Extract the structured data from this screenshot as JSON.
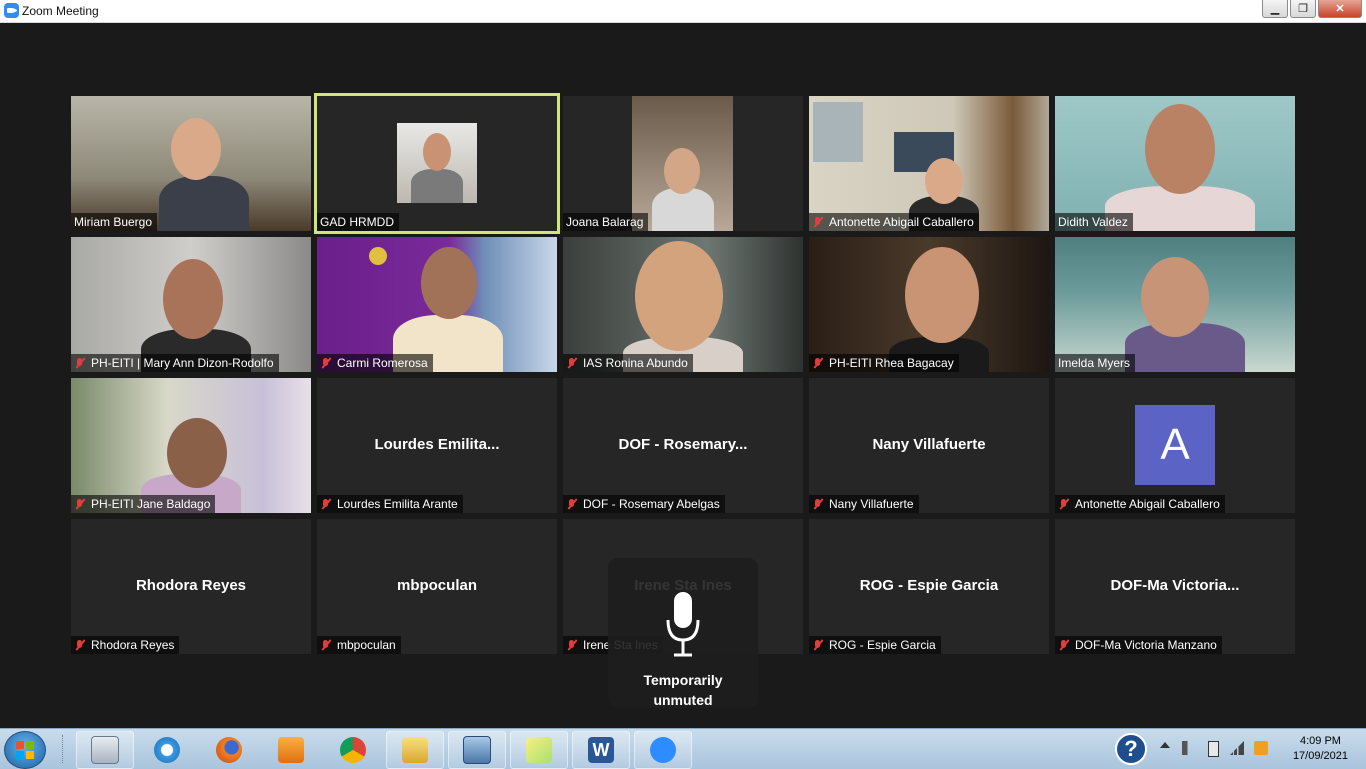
{
  "window": {
    "title": "Zoom Meeting",
    "minimize": "▁",
    "restore": "❐",
    "close": "✕"
  },
  "participants": [
    {
      "label": "Miriam Buergo",
      "muted": false,
      "video": true,
      "bg": "#8e8a7a"
    },
    {
      "label": "GAD HRMDD",
      "muted": false,
      "video": true,
      "active": true,
      "bg": "#262626"
    },
    {
      "label": "Joana Balarag",
      "muted": false,
      "video": true,
      "bg": "#262626"
    },
    {
      "label": "Antonette Abigail Caballero",
      "muted": true,
      "video": true,
      "bg": "#cfc8b8"
    },
    {
      "label": "Didith Valdez",
      "muted": false,
      "video": true,
      "bg": "#8fbcbc"
    },
    {
      "label": "PH-EITI | Mary Ann Dizon-Rodolfo",
      "muted": true,
      "video": true,
      "bg": "#b8b6b2"
    },
    {
      "label": "Carmi Romerosa",
      "muted": true,
      "video": true,
      "bg": "#7a2a9a"
    },
    {
      "label": "IAS Ronina Abundo",
      "muted": true,
      "video": true,
      "bg": "#545a56"
    },
    {
      "label": "PH-EITI Rhea Bagacay",
      "muted": true,
      "video": true,
      "bg": "#3a2a20"
    },
    {
      "label": "Imelda Myers",
      "muted": false,
      "video": true,
      "bg": "#5f8e8e"
    },
    {
      "label": "PH-EITI Jane Baldago",
      "muted": true,
      "video": true,
      "bg": "#c8c0a8"
    },
    {
      "label": "Lourdes Emilita Arante",
      "display": "Lourdes  Emilita...",
      "muted": true,
      "video": false
    },
    {
      "label": "DOF - Rosemary Abelgas",
      "display": "DOF  - Rosemary...",
      "muted": true,
      "video": false
    },
    {
      "label": "Nany Villafuerte",
      "display": "Nany Villafuerte",
      "muted": true,
      "video": false
    },
    {
      "label": "Antonette Abigail Caballero",
      "avatar": "A",
      "muted": true,
      "video": false
    },
    {
      "label": "Rhodora Reyes",
      "display": "Rhodora Reyes",
      "muted": true,
      "video": false
    },
    {
      "label": "mbpoculan",
      "display": "mbpoculan",
      "muted": true,
      "video": false
    },
    {
      "label": "Irene Sta Ines",
      "display": "Irene Sta Ines",
      "muted": true,
      "video": false
    },
    {
      "label": "ROG - Espie Garcia",
      "display": "ROG - Espie Garcia",
      "muted": true,
      "video": false
    },
    {
      "label": "DOF-Ma Victoria Manzano",
      "display": "DOF-Ma  Victoria...",
      "muted": true,
      "video": false
    }
  ],
  "overlay": {
    "line1": "Temporarily",
    "line2": "unmuted"
  },
  "taskbar": {
    "apps": [
      "calculator-icon",
      "internet-explorer-icon",
      "firefox-icon",
      "media-player-icon",
      "chrome-icon",
      "file-explorer-icon",
      "remote-desktop-icon",
      "sticky-notes-icon",
      "word-icon",
      "zoom-icon"
    ],
    "help": "?",
    "time": "4:09 PM",
    "date": "17/09/2021"
  },
  "colors": {
    "active_border": "#d1e67a",
    "muted_mic": "#e03e3e",
    "avatar_bg": "#5b63c4"
  }
}
